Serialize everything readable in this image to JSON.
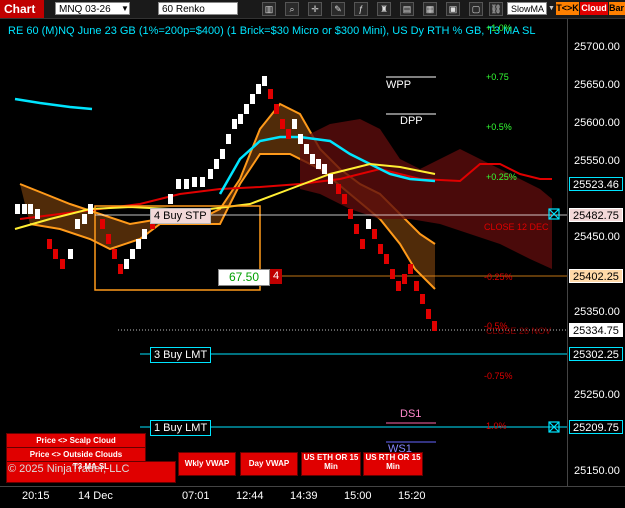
{
  "toolbar": {
    "chart_label": "Chart",
    "instrument": "MNQ 03-26",
    "bar_type": "60 Renko",
    "indicator_select": "SlowMA",
    "tck_label": "T<>K",
    "cloud_label": "Cloud",
    "bar_label": "Bar"
  },
  "title": "RE 60 (M)NQ June 23 GB (1%=200p=$400) (1 Brick=$30 Micro or $300 Mini), US Dy RTH % GB, T3 MA SL",
  "price_axis": {
    "ticks": [
      "25700.00",
      "25650.00",
      "25600.00",
      "25550.00",
      "25450.00",
      "25350.00",
      "25250.00",
      "25150.00"
    ],
    "markers": {
      "current": "25523.46",
      "stop": "25482.75",
      "mid": "25402.25",
      "last": "25334.75",
      "buy3": "25302.25",
      "buy1": "25209.75"
    }
  },
  "time_axis": [
    "20:15",
    "14 Dec",
    "07:01",
    "12:44",
    "14:39",
    "15:00",
    "15:20"
  ],
  "orders": {
    "buy4_label": "4 Buy STP",
    "buy3_label": "3 Buy LMT",
    "buy1_label": "1 Buy LMT"
  },
  "position": {
    "value": "67.50",
    "qty": "4"
  },
  "percent_levels": [
    "+1.0%",
    "+0.75",
    "+0.5%",
    "+0.25%",
    "-0.25%",
    "-0.5%",
    "-0.75%",
    "1.0%"
  ],
  "level_labels": {
    "close_12dec": "CLOSE 12 DEC",
    "close_26nov": "CLOSE 26 NOV"
  },
  "pivots": {
    "wpp": "WPP",
    "dpp": "DPP",
    "ds1": "DS1",
    "ws1": "WS1"
  },
  "buttons": {
    "scalp_cloud": "Price <> Scalp Cloud",
    "outside_clouds": "Price <> Outside Clouds",
    "t3_ma": "T3 MA SL",
    "wkly_vwap": "Wkly VWAP",
    "day_vwap": "Day VWAP",
    "us_eth": "US ETH OR 15 Min",
    "us_rth": "US RTH OR 15 Min"
  },
  "copyright": "© 2025 NinjaTrader, LLC",
  "colors": {
    "cyan": "#00e5ff",
    "red": "#e00000",
    "orange": "#ff9a1a",
    "yellow": "#ffee33",
    "green": "#33ff33"
  }
}
